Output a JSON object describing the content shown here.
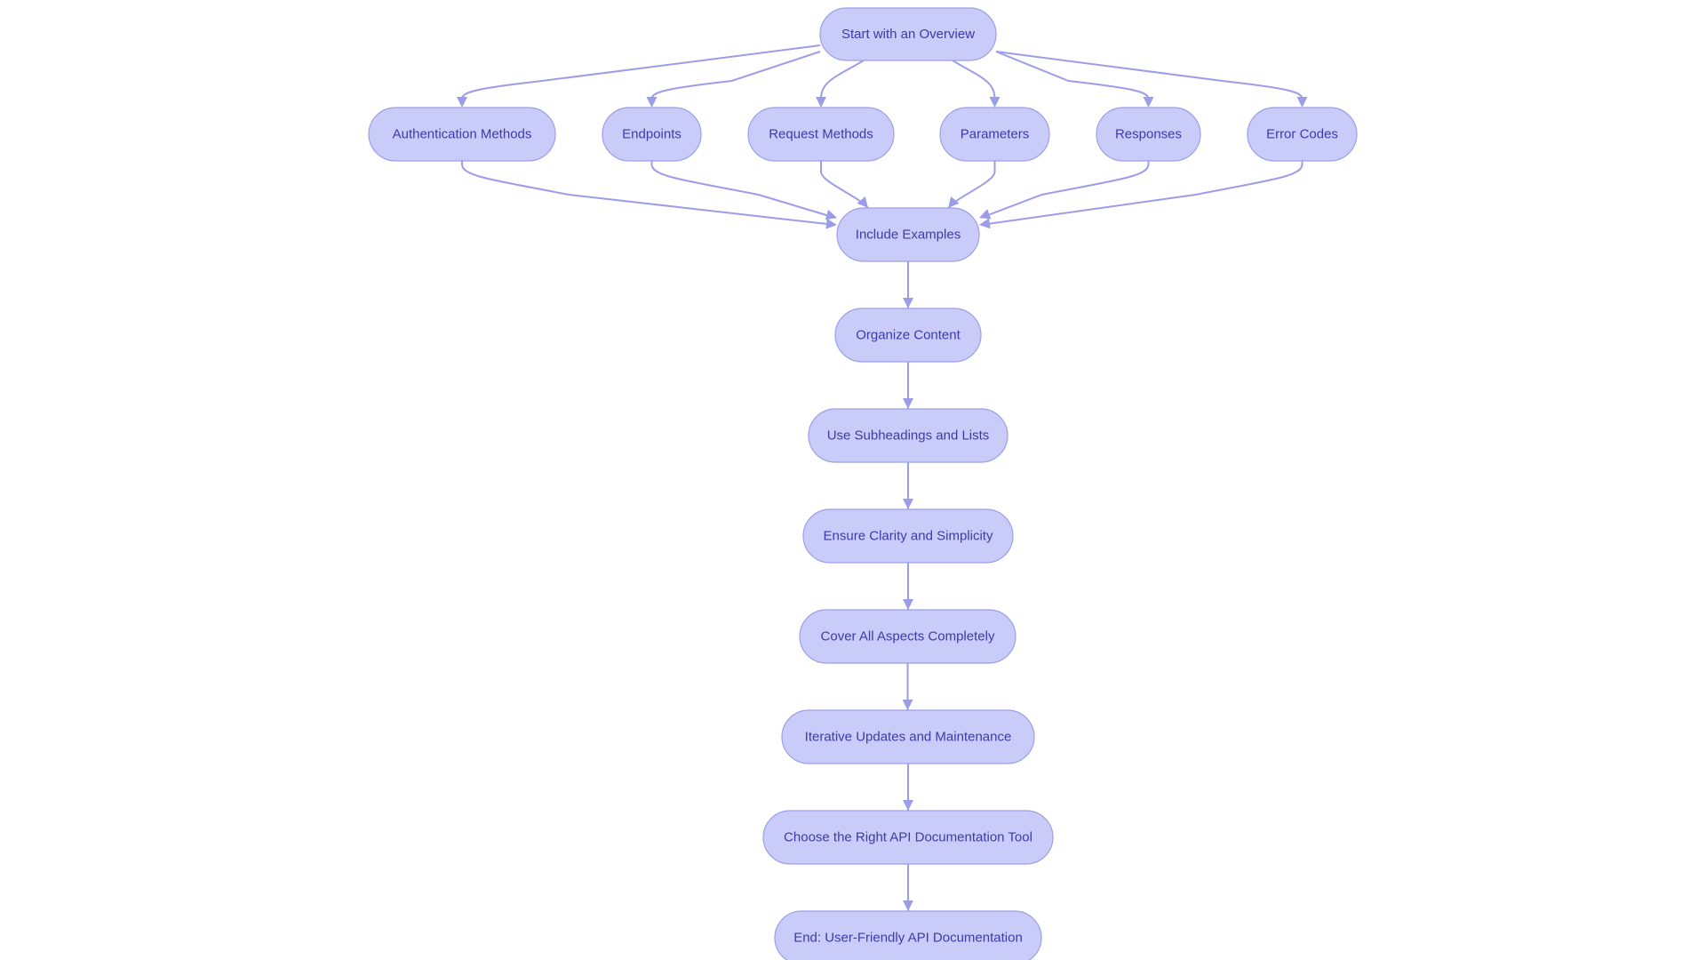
{
  "diagram": {
    "type": "flowchart",
    "colors": {
      "node_fill": "#c9cbf9",
      "node_stroke": "#9d9fe6",
      "node_text": "#3b3ca8",
      "edge": "#9c9de8"
    },
    "nodes": [
      {
        "id": "start",
        "label": "Start with an Overview"
      },
      {
        "id": "auth",
        "label": "Authentication Methods"
      },
      {
        "id": "endpoints",
        "label": "Endpoints"
      },
      {
        "id": "request",
        "label": "Request Methods"
      },
      {
        "id": "params",
        "label": "Parameters"
      },
      {
        "id": "responses",
        "label": "Responses"
      },
      {
        "id": "errors",
        "label": "Error Codes"
      },
      {
        "id": "examples",
        "label": "Include Examples"
      },
      {
        "id": "organize",
        "label": "Organize Content"
      },
      {
        "id": "subheadings",
        "label": "Use Subheadings and Lists"
      },
      {
        "id": "clarity",
        "label": "Ensure Clarity and Simplicity"
      },
      {
        "id": "cover",
        "label": "Cover All Aspects Completely"
      },
      {
        "id": "iterative",
        "label": "Iterative Updates and Maintenance"
      },
      {
        "id": "tool",
        "label": "Choose the Right API Documentation Tool"
      },
      {
        "id": "end",
        "label": "End: User-Friendly API Documentation"
      }
    ],
    "edges": [
      {
        "from": "start",
        "to": "auth"
      },
      {
        "from": "start",
        "to": "endpoints"
      },
      {
        "from": "start",
        "to": "request"
      },
      {
        "from": "start",
        "to": "params"
      },
      {
        "from": "start",
        "to": "responses"
      },
      {
        "from": "start",
        "to": "errors"
      },
      {
        "from": "auth",
        "to": "examples"
      },
      {
        "from": "endpoints",
        "to": "examples"
      },
      {
        "from": "request",
        "to": "examples"
      },
      {
        "from": "params",
        "to": "examples"
      },
      {
        "from": "responses",
        "to": "examples"
      },
      {
        "from": "errors",
        "to": "examples"
      },
      {
        "from": "examples",
        "to": "organize"
      },
      {
        "from": "organize",
        "to": "subheadings"
      },
      {
        "from": "subheadings",
        "to": "clarity"
      },
      {
        "from": "clarity",
        "to": "cover"
      },
      {
        "from": "cover",
        "to": "iterative"
      },
      {
        "from": "iterative",
        "to": "tool"
      },
      {
        "from": "tool",
        "to": "end"
      }
    ]
  }
}
